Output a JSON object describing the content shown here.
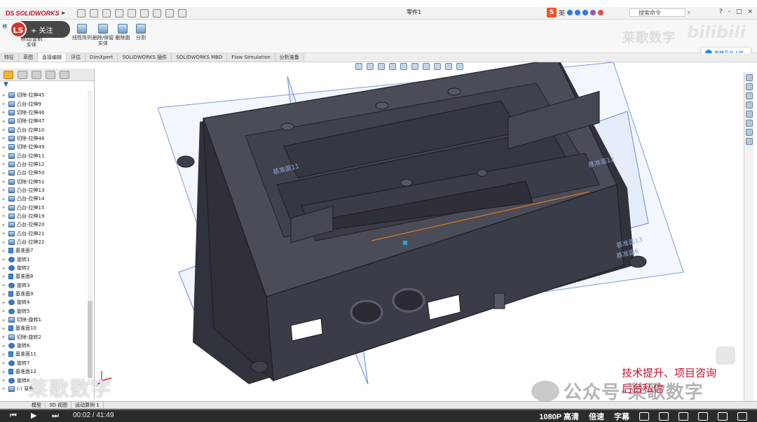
{
  "app": {
    "name": "SOLIDWORKS",
    "document_title": "零件1",
    "search_placeholder": "搜索命令",
    "ime": {
      "lang": "英"
    },
    "window_controls": [
      "?",
      "-",
      "□",
      "×"
    ]
  },
  "ribbon": {
    "items": [
      {
        "label": "线性阵列"
      },
      {
        "label": "删除/保留实体"
      },
      {
        "label": "删除面"
      },
      {
        "label": "分割"
      },
      {
        "label": "移动/复制实体"
      }
    ],
    "partial_labels": [
      "移",
      "体"
    ]
  },
  "tabs": [
    "特征",
    "草图",
    "直接编辑",
    "评估",
    "DimXpert",
    "SOLIDWORKS 插件",
    "SOLIDWORKS MBD",
    "Flow Simulation",
    "分析准备"
  ],
  "active_tab": "直接编辑",
  "follow_button": {
    "avatar": "LS",
    "label": "+ 关注"
  },
  "upload_button": {
    "label": "拖拽至此上传"
  },
  "tree": {
    "items": [
      {
        "label": "切除-拉伸45",
        "type": "feature"
      },
      {
        "label": "凸台-拉伸9",
        "type": "feature"
      },
      {
        "label": "切除-拉伸46",
        "type": "feature"
      },
      {
        "label": "切除-拉伸47",
        "type": "feature"
      },
      {
        "label": "凸台-拉伸10",
        "type": "feature"
      },
      {
        "label": "切除-拉伸48",
        "type": "feature"
      },
      {
        "label": "切除-拉伸49",
        "type": "feature"
      },
      {
        "label": "凸台-拉伸11",
        "type": "feature"
      },
      {
        "label": "凸台-拉伸12",
        "type": "feature"
      },
      {
        "label": "凸台-拉伸50",
        "type": "feature"
      },
      {
        "label": "切除-拉伸51",
        "type": "feature"
      },
      {
        "label": "凸台-拉伸13",
        "type": "feature"
      },
      {
        "label": "凸台-拉伸14",
        "type": "feature"
      },
      {
        "label": "凸台-拉伸15",
        "type": "feature"
      },
      {
        "label": "凸台-拉伸19",
        "type": "feature"
      },
      {
        "label": "凸台-拉伸20",
        "type": "feature"
      },
      {
        "label": "凸台-拉伸21",
        "type": "feature"
      },
      {
        "label": "凸台-拉伸22",
        "type": "feature"
      },
      {
        "label": "基准面7",
        "type": "plane"
      },
      {
        "label": "旋转1",
        "type": "revolve"
      },
      {
        "label": "旋转2",
        "type": "revolve"
      },
      {
        "label": "基准面8",
        "type": "plane"
      },
      {
        "label": "旋转3",
        "type": "revolve"
      },
      {
        "label": "基准面9",
        "type": "plane"
      },
      {
        "label": "旋转4",
        "type": "revolve"
      },
      {
        "label": "旋转5",
        "type": "revolve"
      },
      {
        "label": "切除-旋转1",
        "type": "feature"
      },
      {
        "label": "基准面10",
        "type": "plane"
      },
      {
        "label": "切除-旋转2",
        "type": "feature"
      },
      {
        "label": "旋转6",
        "type": "revolve"
      },
      {
        "label": "基准面11",
        "type": "plane"
      },
      {
        "label": "旋转7",
        "type": "revolve"
      },
      {
        "label": "基准面12",
        "type": "plane"
      },
      {
        "label": "旋转8",
        "type": "revolve"
      },
      {
        "label": "(-) 草图",
        "type": "sketch"
      }
    ]
  },
  "viewport": {
    "plane_labels": [
      "基准面11",
      "基准面12",
      "基准面13",
      "基准面6"
    ]
  },
  "model_tabs": [
    "模型",
    "3D 视图",
    "运动算例 1"
  ],
  "player": {
    "current_time": "00:02",
    "total_time": "41:49",
    "progress": 0.0008,
    "quality": "1080P 高清",
    "speed": "倍速",
    "subtitle": "字幕"
  },
  "watermarks": {
    "channel_top": "莱歌数字",
    "channel_bottom": "莱歌数字",
    "wechat": "公众号·莱歌数字",
    "promo_line1": "技术提升、项目咨询",
    "promo_line2": "后台私信"
  },
  "colors": {
    "model_face": "#3d3f4a",
    "plane_blue": "#6a8fd6",
    "promo_red": "#c8102e",
    "progress_accent": "#00a1d6"
  }
}
